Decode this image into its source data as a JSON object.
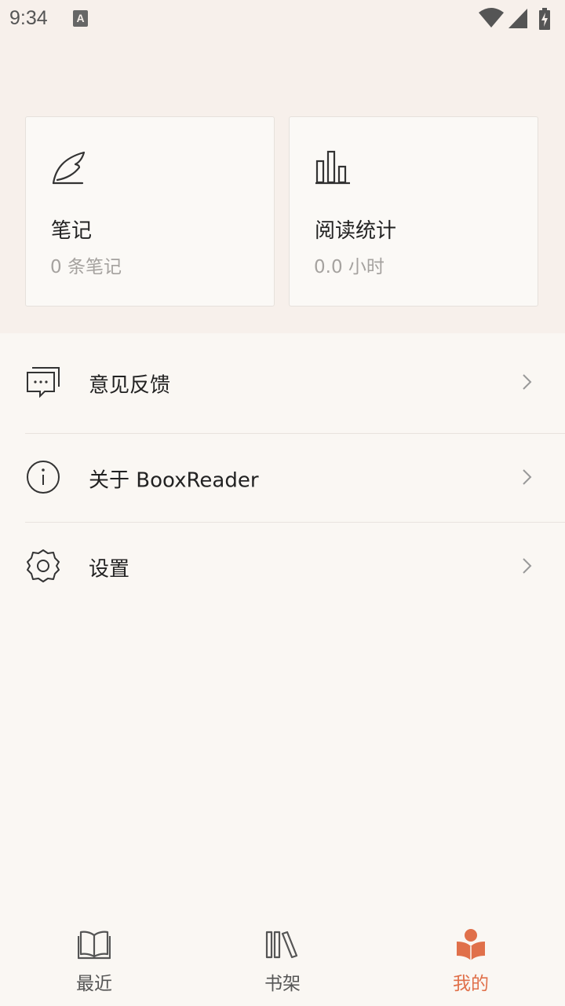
{
  "status_bar": {
    "time": "9:34",
    "notification_glyph": "A"
  },
  "cards": [
    {
      "title": "笔记",
      "subtitle": "0 条笔记",
      "icon": "feather-icon"
    },
    {
      "title": "阅读统计",
      "subtitle": "0.0 小时",
      "icon": "bar-chart-icon"
    }
  ],
  "menu": [
    {
      "label": "意见反馈",
      "icon": "feedback-chat-icon"
    },
    {
      "label": "关于 BooxReader",
      "icon": "info-icon"
    },
    {
      "label": "设置",
      "icon": "gear-icon"
    }
  ],
  "bottom_nav": {
    "items": [
      {
        "label": "最近",
        "icon": "open-book-icon",
        "active": false
      },
      {
        "label": "书架",
        "icon": "bookshelf-icon",
        "active": false
      },
      {
        "label": "我的",
        "icon": "reader-person-icon",
        "active": true
      }
    ]
  },
  "colors": {
    "accent": "#e0704a",
    "top_background": "#f7f0eb",
    "page_background": "#faf7f3"
  }
}
